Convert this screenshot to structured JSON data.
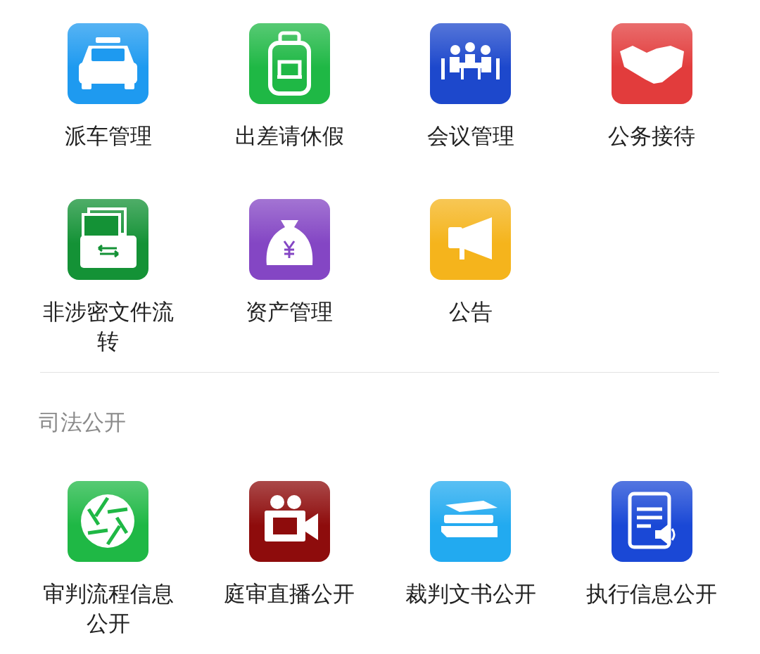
{
  "sections": [
    {
      "items": [
        {
          "label": "派车管理",
          "kind": "car",
          "color": "#1e9af0"
        },
        {
          "label": "出差请休假",
          "kind": "luggage",
          "color": "#1fb845"
        },
        {
          "label": "会议管理",
          "kind": "meeting",
          "color": "#1d48cc"
        },
        {
          "label": "公务接待",
          "kind": "handshake",
          "color": "#e23c3c"
        },
        {
          "label": "非涉密文件流转",
          "kind": "file-transfer",
          "color": "#149236"
        },
        {
          "label": "资产管理",
          "kind": "money-bag",
          "color": "#8446c4"
        },
        {
          "label": "公告",
          "kind": "megaphone",
          "color": "#f5b41c"
        }
      ]
    },
    {
      "title": "司法公开",
      "items": [
        {
          "label": "审判流程信息公开",
          "kind": "aperture",
          "color": "#1fb845"
        },
        {
          "label": "庭审直播公开",
          "kind": "film-camera",
          "color": "#8e0c0c"
        },
        {
          "label": "裁判文书公开",
          "kind": "books",
          "color": "#22aaf0"
        },
        {
          "label": "执行信息公开",
          "kind": "document-audio",
          "color": "#1a48d6"
        }
      ]
    }
  ]
}
